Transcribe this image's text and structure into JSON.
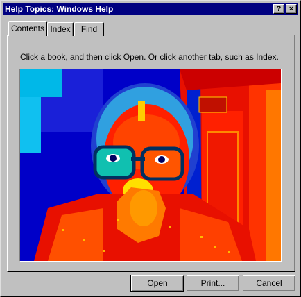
{
  "window": {
    "title": "Help Topics: Windows Help",
    "help_button": "?",
    "close_button": "×"
  },
  "tabs": [
    {
      "label": "Contents",
      "active": true
    },
    {
      "label": "Index",
      "active": false
    },
    {
      "label": "Find",
      "active": false
    }
  ],
  "instruction": "Click a book, and then click Open. Or click another tab, such as Index.",
  "buttons": {
    "open": {
      "mnemonic": "O",
      "rest": "pen"
    },
    "print": {
      "mnemonic": "P",
      "rest": "rint..."
    },
    "cancel": "Cancel"
  },
  "colors": {
    "titlebar": "#000080",
    "face": "#c0c0c0"
  }
}
